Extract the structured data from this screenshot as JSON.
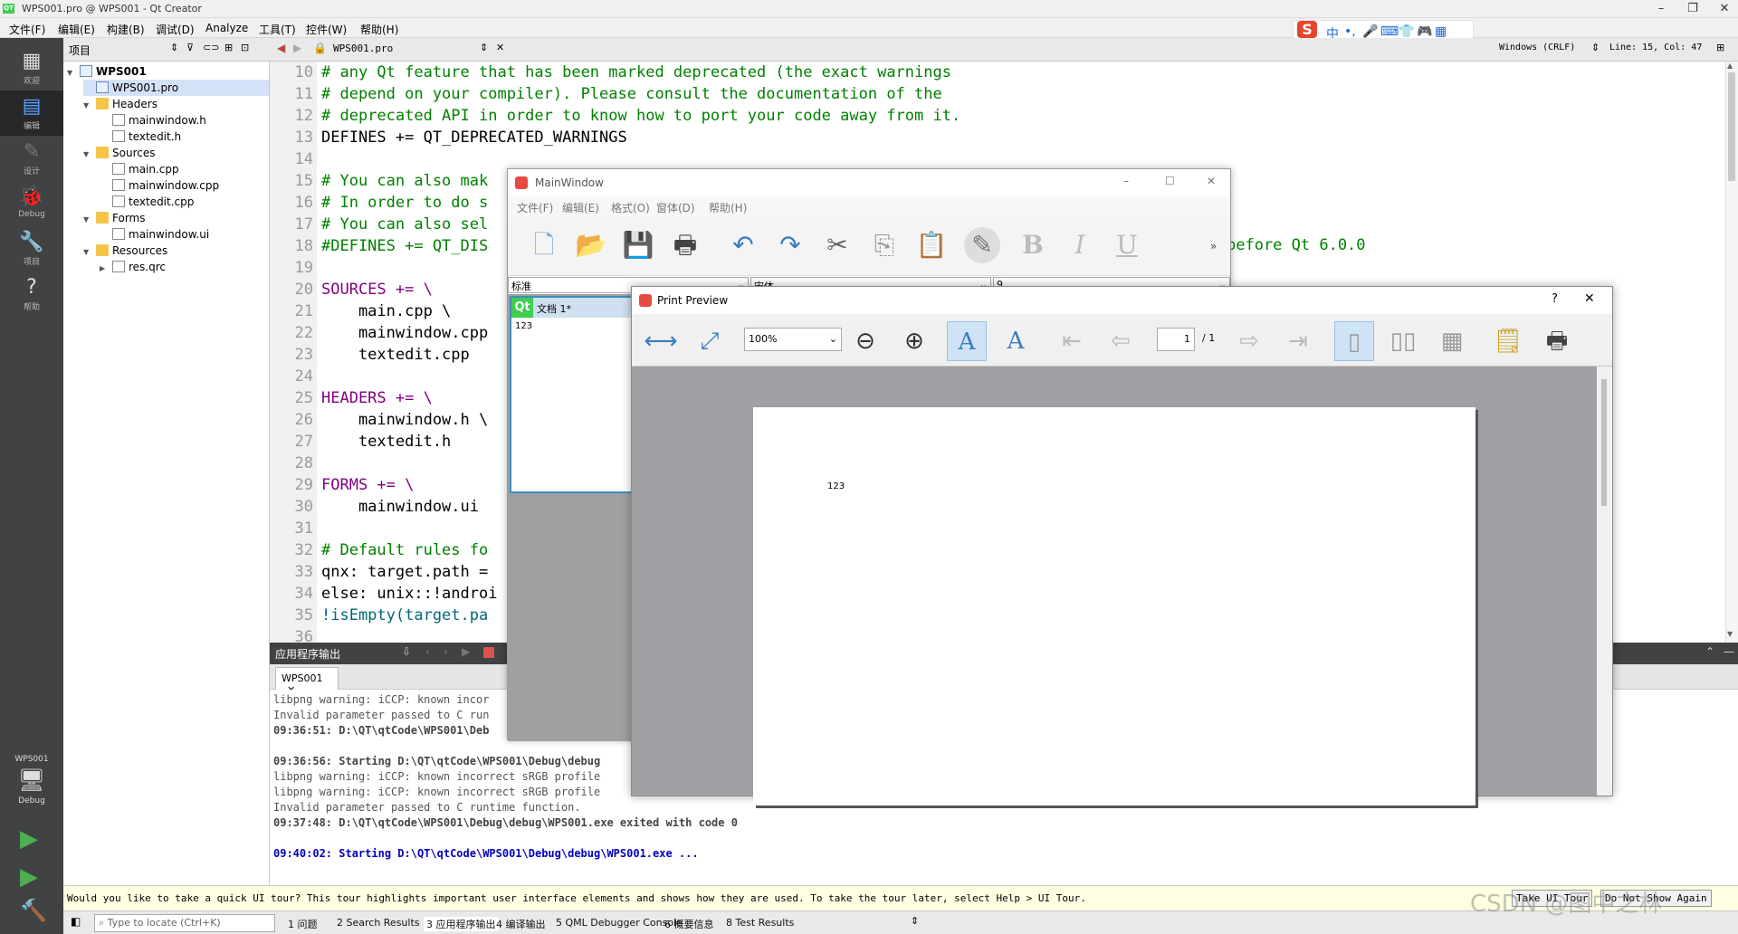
{
  "window": {
    "title": "WPS001.pro @ WPS001 - Qt Creator",
    "qt_icon": "QT"
  },
  "menu": [
    "文件(F)",
    "编辑(E)",
    "构建(B)",
    "调试(D)",
    "Analyze",
    "工具(T)",
    "控件(W)",
    "帮助(H)"
  ],
  "ime": {
    "logo": "S",
    "items": [
      "中",
      "•,",
      "🎤",
      "⌨",
      "👕",
      "🎮",
      "▦"
    ]
  },
  "modes": [
    {
      "label": "欢迎",
      "icon": "grid-icon"
    },
    {
      "label": "编辑",
      "icon": "edit-icon"
    },
    {
      "label": "设计",
      "icon": "pen-icon"
    },
    {
      "label": "Debug",
      "icon": "bug-icon"
    },
    {
      "label": "项目",
      "icon": "wrench-icon"
    },
    {
      "label": "帮助",
      "icon": "help-icon"
    }
  ],
  "kit": {
    "project": "WPS001",
    "config": "Debug"
  },
  "project_pane": {
    "title": "项目"
  },
  "tree": [
    {
      "label": "WPS001",
      "depth": 0,
      "arrow": "▼",
      "kind": "pro",
      "bold": true
    },
    {
      "label": "WPS001.pro",
      "depth": 1,
      "arrow": "",
      "kind": "pro",
      "selected": true
    },
    {
      "label": "Headers",
      "depth": 1,
      "arrow": "▼",
      "kind": "folder"
    },
    {
      "label": "mainwindow.h",
      "depth": 2,
      "arrow": "",
      "kind": "file"
    },
    {
      "label": "textedit.h",
      "depth": 2,
      "arrow": "",
      "kind": "file"
    },
    {
      "label": "Sources",
      "depth": 1,
      "arrow": "▼",
      "kind": "folder"
    },
    {
      "label": "main.cpp",
      "depth": 2,
      "arrow": "",
      "kind": "file"
    },
    {
      "label": "mainwindow.cpp",
      "depth": 2,
      "arrow": "",
      "kind": "file"
    },
    {
      "label": "textedit.cpp",
      "depth": 2,
      "arrow": "",
      "kind": "file"
    },
    {
      "label": "Forms",
      "depth": 1,
      "arrow": "▼",
      "kind": "folder"
    },
    {
      "label": "mainwindow.ui",
      "depth": 2,
      "arrow": "",
      "kind": "file"
    },
    {
      "label": "Resources",
      "depth": 1,
      "arrow": "▼",
      "kind": "folder"
    },
    {
      "label": "res.qrc",
      "depth": 2,
      "arrow": "▶",
      "kind": "file"
    }
  ],
  "editor": {
    "filename": "WPS001.pro",
    "encoding": "Windows (CRLF)",
    "position": "Line: 15, Col: 47",
    "lines": [
      {
        "n": "10",
        "t": "# any Qt feature that has been marked deprecated (the exact warnings",
        "c": "cmt"
      },
      {
        "n": "11",
        "t": "# depend on your compiler). Please consult the documentation of the",
        "c": "cmt"
      },
      {
        "n": "12",
        "t": "# deprecated API in order to know how to port your code away from it.",
        "c": "cmt"
      },
      {
        "n": "13",
        "t": "DEFINES += QT_DEPRECATED_WARNINGS",
        "c": ""
      },
      {
        "n": "14",
        "t": "",
        "c": ""
      },
      {
        "n": "15",
        "t": "# You can also mak",
        "c": "cmt"
      },
      {
        "n": "16",
        "t": "# In order to do s",
        "c": "cmt"
      },
      {
        "n": "17",
        "t": "# You can also sel",
        "c": "cmt"
      },
      {
        "n": "18",
        "t": "#DEFINES += QT_DIS",
        "c": "cmt"
      },
      {
        "n": "19",
        "t": "",
        "c": ""
      },
      {
        "n": "20",
        "t": "SOURCES += \\",
        "c": "kw"
      },
      {
        "n": "21",
        "t": "    main.cpp \\",
        "c": ""
      },
      {
        "n": "22",
        "t": "    mainwindow.cpp",
        "c": ""
      },
      {
        "n": "23",
        "t": "    textedit.cpp",
        "c": ""
      },
      {
        "n": "24",
        "t": "",
        "c": ""
      },
      {
        "n": "25",
        "t": "HEADERS += \\",
        "c": "kw"
      },
      {
        "n": "26",
        "t": "    mainwindow.h \\",
        "c": ""
      },
      {
        "n": "27",
        "t": "    textedit.h",
        "c": ""
      },
      {
        "n": "28",
        "t": "",
        "c": ""
      },
      {
        "n": "29",
        "t": "FORMS += \\",
        "c": "kw"
      },
      {
        "n": "30",
        "t": "    mainwindow.ui",
        "c": ""
      },
      {
        "n": "31",
        "t": "",
        "c": ""
      },
      {
        "n": "32",
        "t": "# Default rules fo",
        "c": "cmt"
      },
      {
        "n": "33",
        "t": "qnx: target.path =",
        "c": ""
      },
      {
        "n": "34",
        "t": "else: unix::!androi",
        "c": ""
      },
      {
        "n": "35",
        "t": "!isEmpty(target.pa",
        "c": "fn"
      },
      {
        "n": "36",
        "t": "",
        "c": ""
      }
    ],
    "trailing": "before Qt 6.0.0"
  },
  "output": {
    "title": "应用程序输出",
    "tab": "WPS001",
    "lines": [
      {
        "t": "libpng warning: iCCP: known incor",
        "s": ""
      },
      {
        "t": "Invalid parameter passed to C run",
        "s": ""
      },
      {
        "t": "09:36:51: D:\\QT\\qtCode\\WPS001\\Deb",
        "s": "b"
      },
      {
        "t": "",
        "s": ""
      },
      {
        "t": "09:36:56: Starting D:\\QT\\qtCode\\WPS001\\Debug\\debug",
        "s": "b"
      },
      {
        "t": "libpng warning: iCCP: known incorrect sRGB profile",
        "s": ""
      },
      {
        "t": "libpng warning: iCCP: known incorrect sRGB profile",
        "s": ""
      },
      {
        "t": "Invalid parameter passed to C runtime function.",
        "s": ""
      },
      {
        "t": "09:37:48: D:\\QT\\qtCode\\WPS001\\Debug\\debug\\WPS001.exe exited with code 0",
        "s": "b"
      },
      {
        "t": "",
        "s": ""
      },
      {
        "t": "09:40:02: Starting D:\\QT\\qtCode\\WPS001\\Debug\\debug\\WPS001.exe ...",
        "s": "blue"
      }
    ]
  },
  "tour": {
    "text": "Would you like to take a quick UI tour? This tour highlights important user interface elements and shows how they are used. To take the tour later, select Help > UI Tour.",
    "take": "Take UI Tour",
    "dont": "Do Not Show Again"
  },
  "status": {
    "locator_placeholder": "Type to locate (Ctrl+K)",
    "tabs": [
      "1 问题",
      "2 Search Results",
      "3 应用程序输出",
      "4 编译输出",
      "5 QML Debugger Console",
      "6 概要信息",
      "8 Test Results"
    ]
  },
  "mainwindow": {
    "title": "MainWindow",
    "menu": [
      "文件(F)",
      "编辑(E)",
      "格式(O)",
      "窗体(D)",
      "帮助(H)"
    ],
    "style_combo": "标准",
    "font_combo": "宋体",
    "size_combo": "9",
    "doc_title": "文档 1*",
    "doc_text": "123",
    "more": "»"
  },
  "preview": {
    "title": "Print Preview",
    "help": "?",
    "zoom": "100%",
    "page": "1",
    "page_total": "/ 1",
    "page_text": "123"
  },
  "watermark": "CSDN @图中之林"
}
